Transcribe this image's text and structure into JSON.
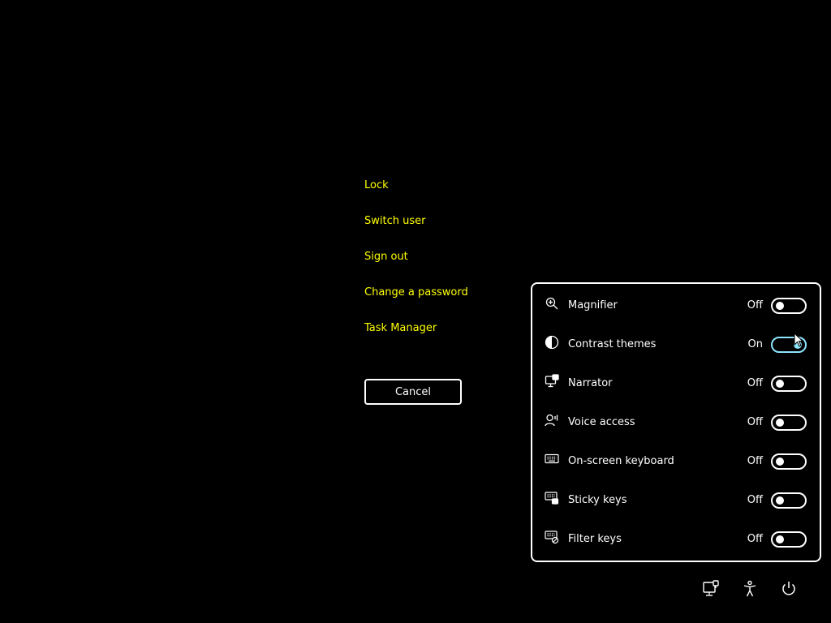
{
  "menu": {
    "lock": "Lock",
    "switch_user": "Switch user",
    "sign_out": "Sign out",
    "change_password": "Change a password",
    "task_manager": "Task Manager",
    "cancel": "Cancel"
  },
  "accessibility": {
    "items": [
      {
        "label": "Magnifier",
        "state": "Off",
        "icon": "magnifier-icon",
        "on": false
      },
      {
        "label": "Contrast themes",
        "state": "On",
        "icon": "contrast-icon",
        "on": true
      },
      {
        "label": "Narrator",
        "state": "Off",
        "icon": "narrator-icon",
        "on": false
      },
      {
        "label": "Voice access",
        "state": "Off",
        "icon": "voice-access-icon",
        "on": false
      },
      {
        "label": "On-screen keyboard",
        "state": "Off",
        "icon": "keyboard-icon",
        "on": false
      },
      {
        "label": "Sticky keys",
        "state": "Off",
        "icon": "sticky-keys-icon",
        "on": false
      },
      {
        "label": "Filter keys",
        "state": "Off",
        "icon": "filter-keys-icon",
        "on": false
      }
    ]
  },
  "system_buttons": [
    "network-icon",
    "accessibility-icon",
    "power-icon"
  ],
  "colors": {
    "background": "#000000",
    "link": "#ffff00",
    "text": "#ffffff",
    "toggle_on": "#8ee4ff"
  }
}
